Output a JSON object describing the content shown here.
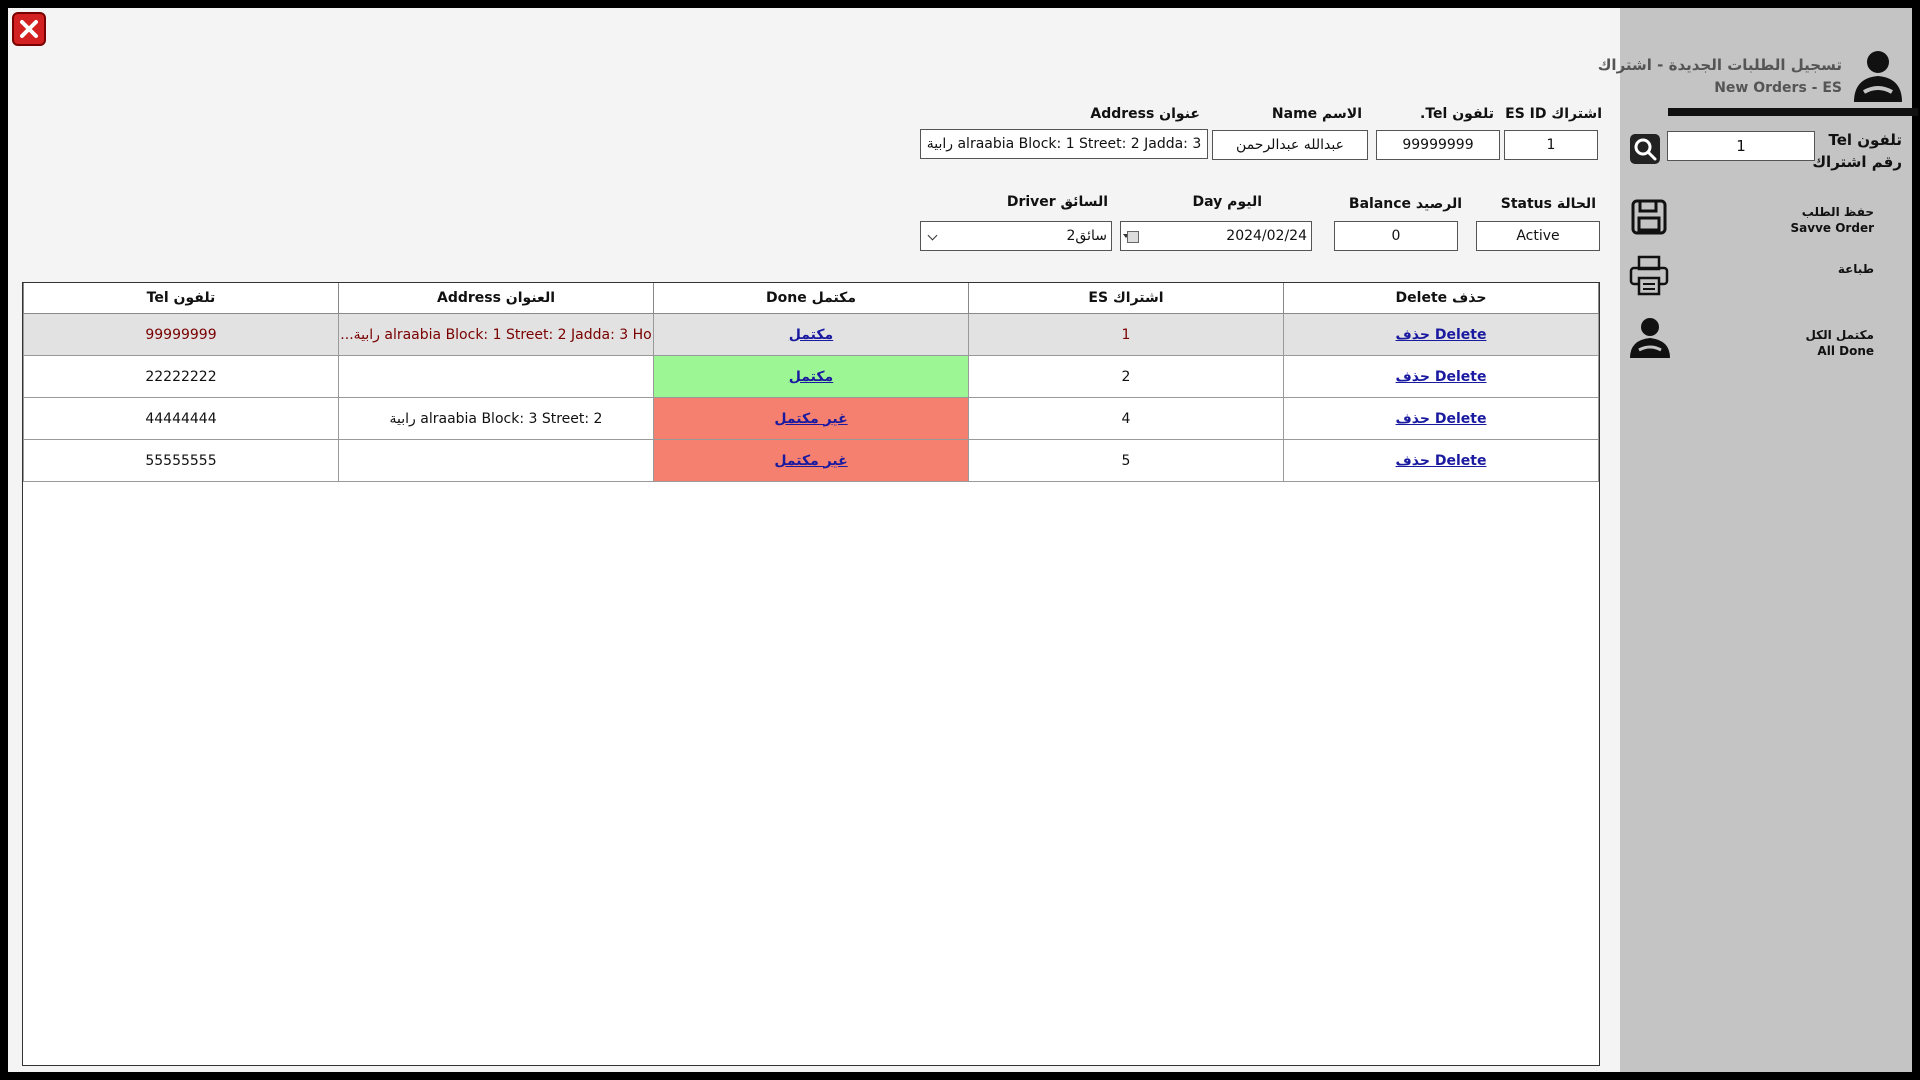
{
  "header": {
    "title_ar": "تسجيل الطلبات الجديدة - اشتراك",
    "title_en": "New Orders  - ES"
  },
  "form": {
    "es_id": {
      "label": "اشتراك ES ID",
      "value": "1"
    },
    "tel": {
      "label": "تلفون Tel.",
      "value": "99999999"
    },
    "name": {
      "label": "الاسم Name",
      "value": "عبدالله عبدالرحمن"
    },
    "address": {
      "label": "عنوان Address",
      "value": "alraabia Block: 1 Street: 2 Jadda: 3 رابية"
    },
    "status": {
      "label": "الحالة Status",
      "value": "Active"
    },
    "balance": {
      "label": "الرصيد Balance",
      "value": "0"
    },
    "day": {
      "label": "اليوم Day",
      "value": "2024/02/24"
    },
    "driver": {
      "label": "السائق Driver",
      "value": "سائق2"
    }
  },
  "table": {
    "columns": [
      "حذف Delete",
      "اشتراك ES",
      "مكتمل Done",
      "العنوان Address",
      "تلفون Tel"
    ],
    "rows": [
      {
        "delete": "حذف Delete",
        "es": "1",
        "done": "مكتمل",
        "address": "alraabia Block: 1 Street: 2 Jadda: 3 Ho رابية...",
        "tel": "99999999"
      },
      {
        "delete": "حذف Delete",
        "es": "2",
        "done": "مكتمل",
        "address": "",
        "tel": "22222222"
      },
      {
        "delete": "حذف Delete",
        "es": "4",
        "done": "غير مكتمل",
        "address": "alraabia Block: 3 Street: 2 رابية",
        "tel": "44444444"
      },
      {
        "delete": "حذف Delete",
        "es": "5",
        "done": "غير مكتمل",
        "address": "",
        "tel": "55555555"
      }
    ]
  },
  "sidebar": {
    "search_label_1": "تلفون Tel",
    "search_label_2": "رقم اشتراك",
    "search_value": "1",
    "save_ar": "حفظ الطلب",
    "save_en": "Savve Order",
    "print_ar": "طباعة",
    "all_done_ar": "مكتمل الكل",
    "all_done_en": "All Done"
  },
  "colors": {
    "done_green": "#9df694",
    "not_done_red": "#f5806f",
    "sidebar_bg": "#c4c4c4",
    "close_red": "#d32020"
  },
  "icons": {
    "close": "close-icon",
    "user": "user-icon",
    "search": "search-icon",
    "save": "save-icon",
    "print": "printer-icon",
    "all_done": "user-icon"
  }
}
